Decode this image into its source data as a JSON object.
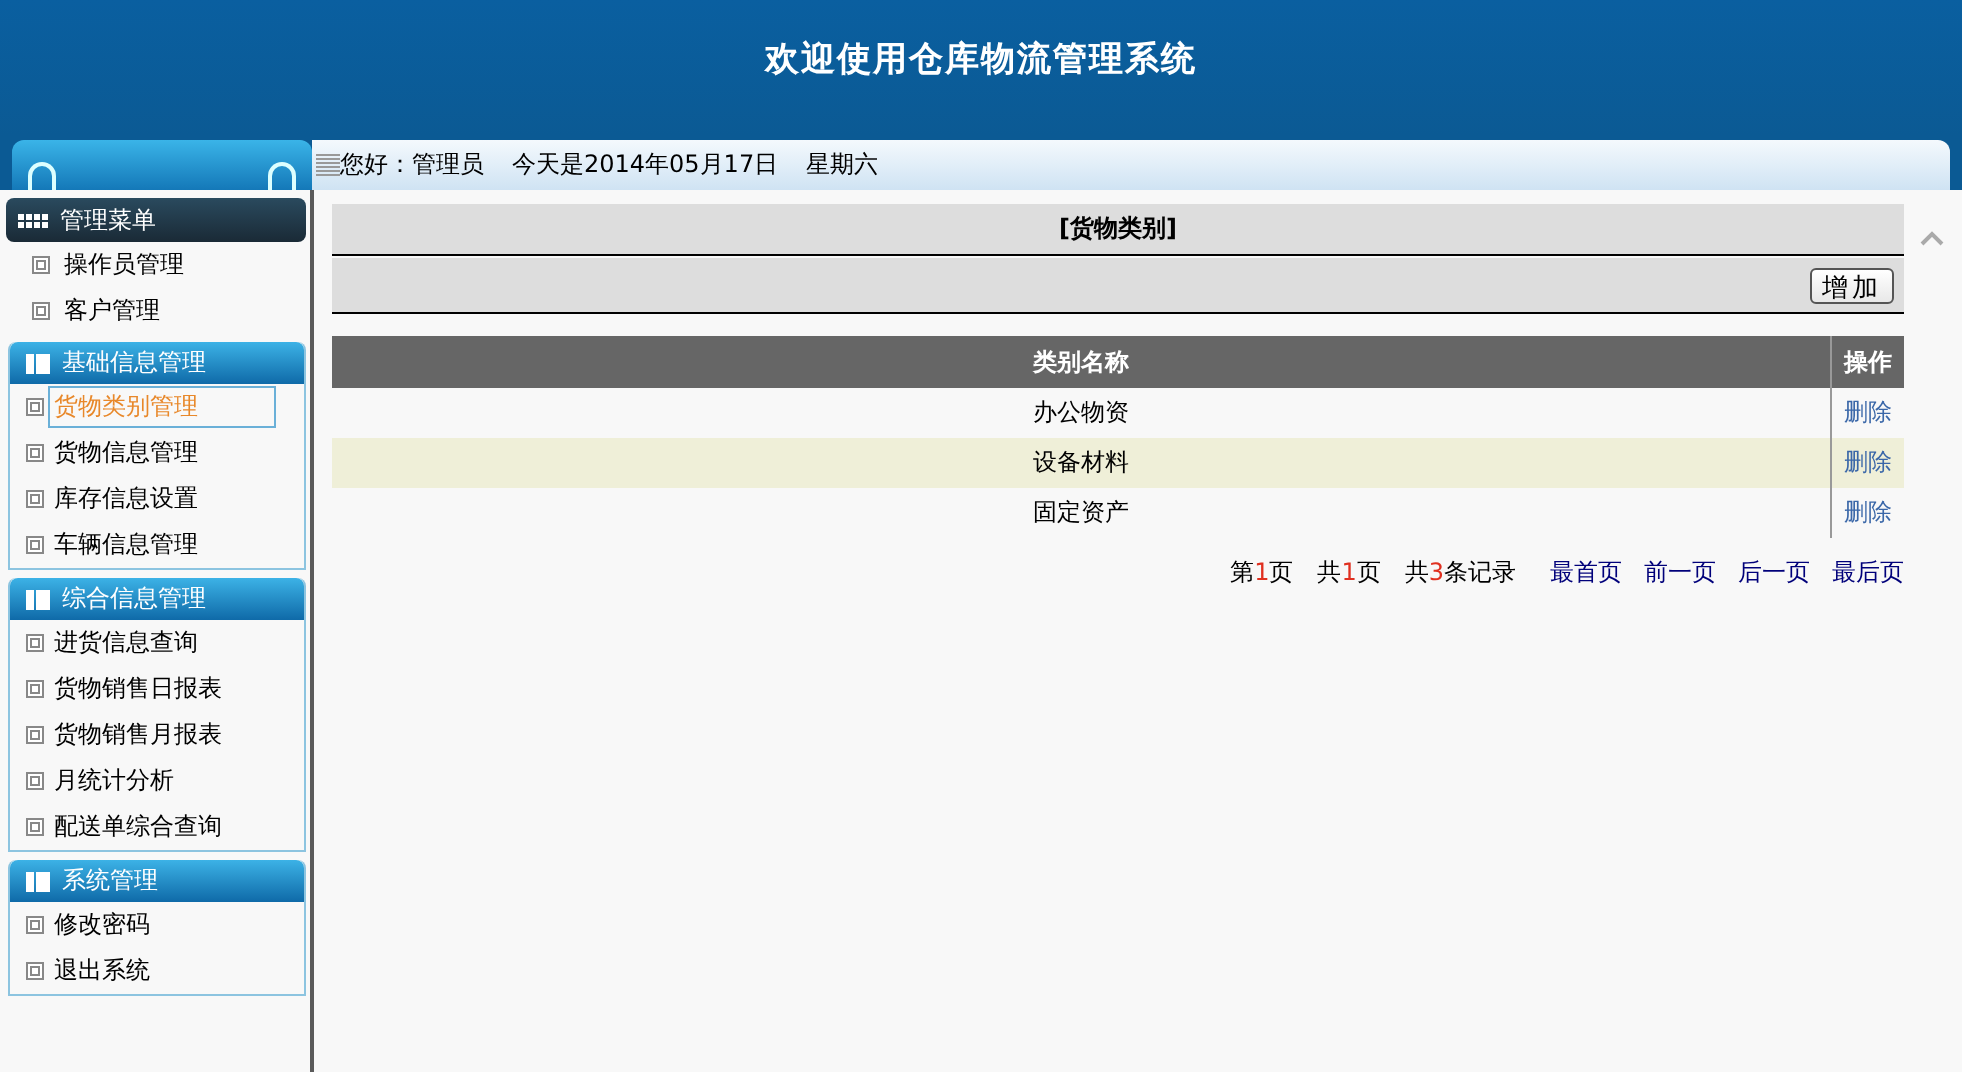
{
  "header": {
    "title": "欢迎使用仓库物流管理系统"
  },
  "welcome": {
    "greeting": "您好：管理员",
    "date": "今天是2014年05月17日",
    "weekday": "星期六"
  },
  "sidebar": {
    "title": "管理菜单",
    "items": [
      {
        "label": "操作员管理",
        "selected": false
      },
      {
        "label": "客户管理",
        "selected": false
      }
    ],
    "groups": [
      {
        "title": "基础信息管理",
        "items": [
          {
            "label": "货物类别管理",
            "selected": true
          },
          {
            "label": "货物信息管理",
            "selected": false
          },
          {
            "label": "库存信息设置",
            "selected": false
          },
          {
            "label": "车辆信息管理",
            "selected": false
          }
        ]
      },
      {
        "title": "综合信息管理",
        "items": [
          {
            "label": "进货信息查询",
            "selected": false
          },
          {
            "label": "货物销售日报表",
            "selected": false
          },
          {
            "label": "货物销售月报表",
            "selected": false
          },
          {
            "label": "月统计分析",
            "selected": false
          },
          {
            "label": "配送单综合查询",
            "selected": false
          }
        ]
      },
      {
        "title": "系统管理",
        "items": [
          {
            "label": "修改密码",
            "selected": false
          },
          {
            "label": "退出系统",
            "selected": false
          }
        ]
      }
    ]
  },
  "content": {
    "title": "[货物类别]",
    "add_button": "增加",
    "table": {
      "columns": [
        "类别名称",
        "操作"
      ],
      "rows": [
        {
          "name": "办公物资",
          "action": "删除"
        },
        {
          "name": "设备材料",
          "action": "删除"
        },
        {
          "name": "固定资产",
          "action": "删除"
        }
      ]
    },
    "pager": {
      "counts": [
        {
          "before": "第",
          "number": "1",
          "after": "页"
        },
        {
          "before": "共",
          "number": "1",
          "after": "页"
        },
        {
          "before": "共",
          "number": "3",
          "after": "条记录"
        }
      ],
      "links": [
        "最首页",
        "前一页",
        "后一页",
        "最后页"
      ]
    }
  }
}
